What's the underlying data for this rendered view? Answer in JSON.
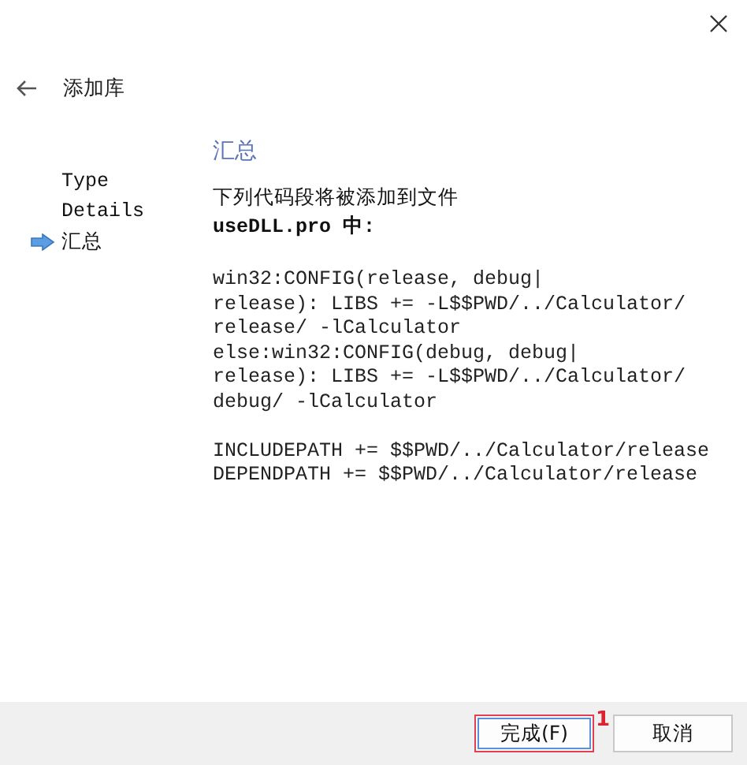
{
  "window": {
    "title": "添加库"
  },
  "steps": [
    {
      "label": "Type",
      "selected": false
    },
    {
      "label": "Details",
      "selected": false
    },
    {
      "label": "汇总",
      "selected": true
    }
  ],
  "page": {
    "heading": "汇总",
    "intro": "下列代码段将被添加到文件",
    "file_line": "useDLL.pro 中:",
    "code_blocks": [
      [
        "win32:CONFIG(release, debug|",
        "release): LIBS += -L$$PWD/../Calculator/",
        "release/ -lCalculator",
        "else:win32:CONFIG(debug, debug|",
        "release): LIBS += -L$$PWD/../Calculator/",
        "debug/ -lCalculator"
      ],
      [
        "INCLUDEPATH += $$PWD/../Calculator/release",
        "DEPENDPATH += $$PWD/../Calculator/release"
      ]
    ]
  },
  "buttons": [
    {
      "label": "完成(F)",
      "highlighted": true
    },
    {
      "label": "取消",
      "highlighted": false
    }
  ],
  "annotation": {
    "label": "1"
  }
}
